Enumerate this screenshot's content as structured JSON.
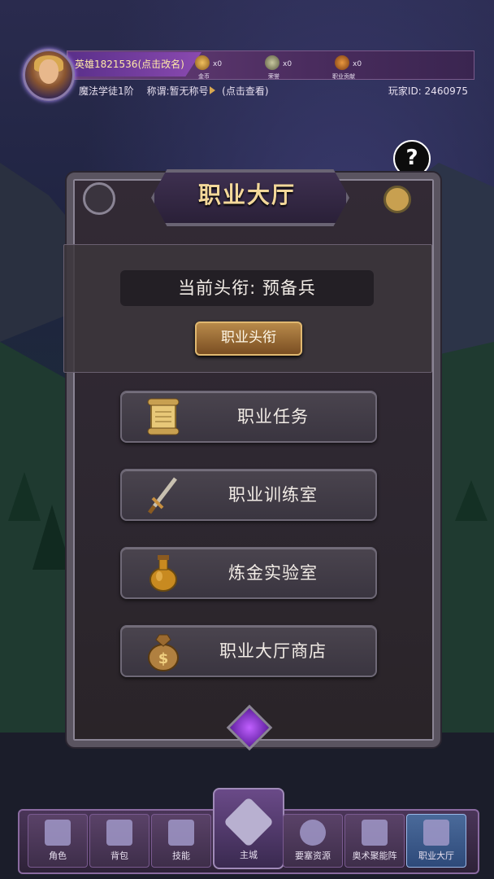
{
  "header": {
    "player_name": "英雄1821536(点击改名)",
    "class_rank": "魔法学徒1阶",
    "title_label": "称谓:暂无称号",
    "title_action": "(点击查看)",
    "player_id": "玩家ID: 2460975",
    "resources": [
      {
        "icon": "gold-coin-icon",
        "label": "金币",
        "count": "x0",
        "color": "#c8902a"
      },
      {
        "icon": "honor-medal-icon",
        "label": "荣誉",
        "count": "x0",
        "color": "#8a8a70"
      },
      {
        "icon": "guild-contribution-icon",
        "label": "职业贡献",
        "count": "x0",
        "color": "#c87830"
      }
    ]
  },
  "help_button": "?",
  "panel": {
    "title": "职业大厅",
    "current_rank": "当前头衔: 预备兵",
    "rank_button": "职业头衔",
    "menu": [
      {
        "label": "职业任务",
        "icon": "scroll-icon"
      },
      {
        "label": "职业训练室",
        "icon": "sword-icon"
      },
      {
        "label": "炼金实验室",
        "icon": "potion-flask-icon"
      },
      {
        "label": "职业大厅商店",
        "icon": "money-bag-icon"
      }
    ]
  },
  "nav": {
    "items": [
      {
        "label": "角色",
        "icon": "character-icon"
      },
      {
        "label": "背包",
        "icon": "backpack-icon"
      },
      {
        "label": "技能",
        "icon": "skill-book-icon"
      },
      {
        "label": "主城",
        "icon": "main-city-emblem-icon"
      },
      {
        "label": "要塞资源",
        "icon": "fortress-resource-icon"
      },
      {
        "label": "奥术聚能阵",
        "icon": "arcane-book-icon"
      },
      {
        "label": "职业大厅",
        "icon": "guild-hall-icon"
      }
    ],
    "active": "职业大厅"
  }
}
